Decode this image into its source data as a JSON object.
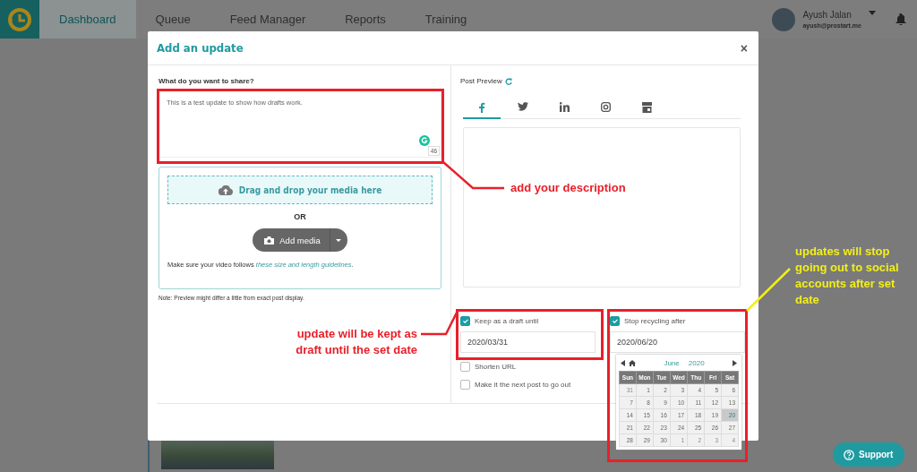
{
  "nav": {
    "items": [
      {
        "label": "Dashboard",
        "selected": true
      },
      {
        "label": "Queue",
        "selected": false
      },
      {
        "label": "Feed Manager",
        "selected": false
      },
      {
        "label": "Reports",
        "selected": false
      },
      {
        "label": "Training",
        "selected": false
      }
    ],
    "user": {
      "name": "Ayush Jalan",
      "email": "ayush@prostart.me"
    }
  },
  "modal": {
    "title": "Add an update",
    "close": "×",
    "share_label": "What do you want to share?",
    "description": {
      "value": "This is a test update to show how drafts work.",
      "char_count": "46"
    },
    "media": {
      "dropzone": "Drag and drop your media here",
      "or": "OR",
      "add_media": "Add media",
      "guideline_prefix": "Make sure your video follows ",
      "guideline_link": "these size and length guidelines",
      "guideline_suffix": "."
    },
    "note": "Note: Preview might differ a little from exact post display.",
    "preview": {
      "title": "Post Preview",
      "tabs": [
        {
          "kind": "facebook",
          "selected": true
        },
        {
          "kind": "twitter",
          "selected": false
        },
        {
          "kind": "linkedin",
          "selected": false
        },
        {
          "kind": "instagram",
          "selected": false
        },
        {
          "kind": "store",
          "selected": false
        }
      ]
    },
    "draft": {
      "label": "Keep as a draft until",
      "checked": true,
      "date": "2020/03/31"
    },
    "options": [
      {
        "label": "Shorten URL",
        "checked": false
      },
      {
        "label": "Make it the next post to go out",
        "checked": false
      }
    ],
    "recycle": {
      "label": "Stop recycling after",
      "checked": true,
      "date": "2020/06/20",
      "calendar": {
        "month": "June",
        "year": "2020",
        "weekdays": [
          "Sun",
          "Mon",
          "Tue",
          "Wed",
          "Thu",
          "Fri",
          "Sat"
        ],
        "weeks": [
          [
            {
              "day": "31",
              "muted": true,
              "selected": false
            },
            {
              "day": "1",
              "muted": false,
              "selected": false
            },
            {
              "day": "2",
              "muted": false,
              "selected": false
            },
            {
              "day": "3",
              "muted": false,
              "selected": false
            },
            {
              "day": "4",
              "muted": false,
              "selected": false
            },
            {
              "day": "5",
              "muted": false,
              "selected": false
            },
            {
              "day": "6",
              "muted": false,
              "selected": false
            }
          ],
          [
            {
              "day": "7",
              "muted": false,
              "selected": false
            },
            {
              "day": "8",
              "muted": false,
              "selected": false
            },
            {
              "day": "9",
              "muted": false,
              "selected": false
            },
            {
              "day": "10",
              "muted": false,
              "selected": false
            },
            {
              "day": "11",
              "muted": false,
              "selected": false
            },
            {
              "day": "12",
              "muted": false,
              "selected": false
            },
            {
              "day": "13",
              "muted": false,
              "selected": false
            }
          ],
          [
            {
              "day": "14",
              "muted": false,
              "selected": false
            },
            {
              "day": "15",
              "muted": false,
              "selected": false
            },
            {
              "day": "16",
              "muted": false,
              "selected": false
            },
            {
              "day": "17",
              "muted": false,
              "selected": false
            },
            {
              "day": "18",
              "muted": false,
              "selected": false
            },
            {
              "day": "19",
              "muted": false,
              "selected": false
            },
            {
              "day": "20",
              "muted": false,
              "selected": true
            }
          ],
          [
            {
              "day": "21",
              "muted": false,
              "selected": false
            },
            {
              "day": "22",
              "muted": false,
              "selected": false
            },
            {
              "day": "23",
              "muted": false,
              "selected": false
            },
            {
              "day": "24",
              "muted": false,
              "selected": false
            },
            {
              "day": "25",
              "muted": false,
              "selected": false
            },
            {
              "day": "26",
              "muted": false,
              "selected": false
            },
            {
              "day": "27",
              "muted": false,
              "selected": false
            }
          ],
          [
            {
              "day": "28",
              "muted": false,
              "selected": false
            },
            {
              "day": "29",
              "muted": false,
              "selected": false
            },
            {
              "day": "30",
              "muted": false,
              "selected": false
            },
            {
              "day": "1",
              "muted": true,
              "selected": false
            },
            {
              "day": "2",
              "muted": true,
              "selected": false
            },
            {
              "day": "3",
              "muted": true,
              "selected": false
            },
            {
              "day": "4",
              "muted": true,
              "selected": false
            }
          ]
        ]
      }
    }
  },
  "annotations": [
    {
      "text": "add your description",
      "color": "#e8202a"
    },
    {
      "text": "update will be kept as draft until the set date",
      "color": "#e8202a"
    },
    {
      "text": "updates will stop going out to social accounts after set date",
      "color": "#f2ee1c"
    }
  ],
  "support": {
    "label": "Support"
  }
}
